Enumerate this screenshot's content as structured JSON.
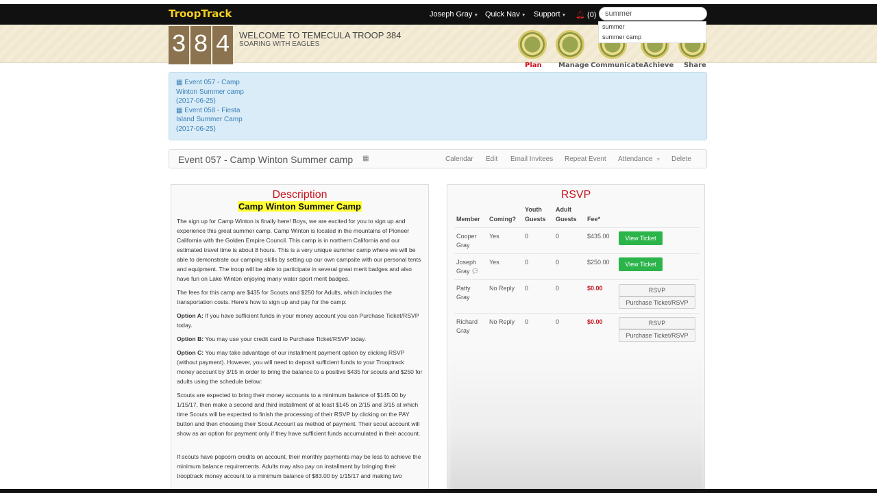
{
  "app": {
    "logo": "TroopTrack"
  },
  "nav": {
    "user": "Joseph Gray",
    "quick_nav": "Quick Nav",
    "support": "Support",
    "notifications": "(0)"
  },
  "search": {
    "value": "summer",
    "suggestions": [
      "summer",
      "summer camp"
    ]
  },
  "troop": {
    "digits": [
      "3",
      "8",
      "4"
    ],
    "welcome": "WELCOME TO TEMECULA TROOP 384",
    "motto": "SOARING WITH EAGLES"
  },
  "badges": [
    {
      "label": "Plan",
      "active": true
    },
    {
      "label": "Manage"
    },
    {
      "label": "Communicate"
    },
    {
      "label": "Achieve"
    },
    {
      "label": "Share"
    }
  ],
  "events_list": [
    {
      "lines": [
        "Event 057 - Camp",
        "Winton Summer camp",
        "(2017-06-25)"
      ]
    },
    {
      "lines": [
        "Event 058 - Fiesta",
        "Island Summer Camp",
        "(2017-06-25)"
      ]
    }
  ],
  "event": {
    "title": "Event 057 - Camp Winton Summer camp"
  },
  "event_actions": [
    "Calendar",
    "Edit",
    "Email Invitees",
    "Repeat Event",
    "Attendance",
    "Delete"
  ],
  "description": {
    "heading": "Description",
    "subheading": "Camp Winton Summer Camp",
    "paragraphs": [
      "The sign up for Camp Winton is finally here! Boys, we are excited for you to sign up and experience this great summer camp. Camp Winton is located in the mountains of Pioneer California with the Golden Empire Council. This camp is in northern California and our estimated travel time is about 8 hours. This is a very unique summer camp where we will be able to demonstrate our camping skills by setting up our own campsite with our personal tents and equipment. The troop will be able to participate in several great merit badges and also have fun on Lake Winton enjoying many water sport merit badges.",
      "The fees for this camp are $435 for Scouts and $250 for Adults, which includes the transportation costs. Here's how to sign up and pay for the camp:"
    ],
    "options": [
      {
        "label": "Option A:",
        "text": " If you have sufficient funds in your money account you can Purchase Ticket/RSVP today."
      },
      {
        "label": "Option B:",
        "text": " You may use your credit card to Purchase Ticket/RSVP today."
      },
      {
        "label": "Option C:",
        "text": " You may take advantage of our installment payment option by clicking RSVP (without payment). However, you will need to deposit sufficient funds to your Trooptrack money account by 3/15 in order to bring the balance to a positive $435 for scouts and $250 for adults using the schedule below:"
      }
    ],
    "scouts_text": "Scouts are expected to bring their money accounts to a minimum balance of $145.00 by 1/15/17, then make a second and third installment of at least $145 on 2/15 and 3/15 at which time Scouts will be expected to finish the processing of their RSVP by clicking on the PAY button and then choosing their Scout Account as method of payment. Their scout account will show as an option for payment only if they have sufficient funds accumulated in their account.",
    "popcorn_text": "If scouts have popcorn credits on account, their monthly payments may be less to achieve the minimum balance requirements. Adults may also pay on installment by bringing their trooptrack money account to a minimum balance of $83.00 by 1/15/17 and making two"
  },
  "rsvp": {
    "heading": "RSVP",
    "columns": {
      "member": "Member",
      "coming": "Coming?",
      "youth": "Youth",
      "youth2": "Guests",
      "adult": "Adult",
      "adult2": "Guests",
      "fee": "Fee*"
    },
    "rows": [
      {
        "first": "Cooper",
        "last": "Gray",
        "coming": "Yes",
        "youth": "0",
        "adult": "0",
        "fee": "$435.00",
        "action": "View Ticket"
      },
      {
        "first": "Joseph",
        "last": "Gray",
        "coming": "Yes",
        "youth": "0",
        "adult": "0",
        "fee": "$250.00",
        "action": "View Ticket",
        "comment": true
      },
      {
        "first": "Patty",
        "last": "Gray",
        "coming": "No Reply",
        "youth": "0",
        "adult": "0",
        "fee": "$0.00",
        "action": "RSVP",
        "action2": "Purchase Ticket/RSVP"
      },
      {
        "first": "Richard",
        "last": "Gray",
        "coming": "No Reply",
        "youth": "0",
        "adult": "0",
        "fee": "$0.00",
        "action": "RSVP",
        "action2": "Purchase Ticket/RSVP"
      }
    ]
  },
  "colors": {
    "accent_red": "#c8141e",
    "logo_yellow": "#f5d020",
    "green_button": "#2bb44a",
    "highlight": "#ffff33",
    "link_blue": "#3a7fb8"
  }
}
